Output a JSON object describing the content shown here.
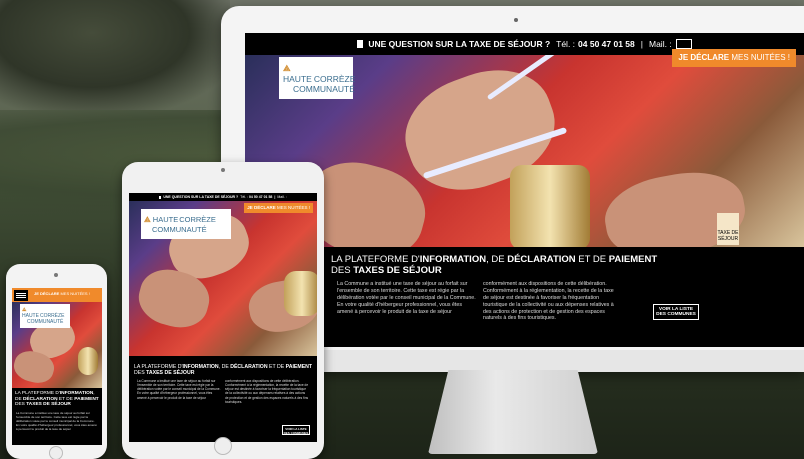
{
  "site": {
    "question_label": "UNE QUESTION SUR LA TAXE DE SÉJOUR ?",
    "tel_label": "Tél. :",
    "tel_value": "04 50 47 01 58",
    "mail_label": "Mail. :",
    "declare_strong": "JE DÉCLARE",
    "declare_light": "MES NUITÉES !",
    "logo_line1": "HAUTE",
    "logo_line1b": "CORRÈZE",
    "logo_line2": "COMMUNAUTÉ",
    "badge_label": "TAXE DE SÉJOUR",
    "title_part1": "LA PLATEFORME D'",
    "title_bold1": "INFORMATION",
    "title_part2": ", DE ",
    "title_bold2": "DÉCLARATION",
    "title_part3": " ET DE ",
    "title_bold3": "PAIEMENT",
    "title_part4": "DES ",
    "title_bold4": "TAXES DE SÉJOUR",
    "col1": "La Commune a institué une taxe de séjour au forfait sur l'ensemble de son territoire. Cette taxe est régie par la délibération votée par le conseil municipal de la Commune. En votre qualité d'hébergeur professionnel, vous êtes amené à percevoir le produit de la taxe de séjour",
    "col2": "conformément aux dispositions de cette délibération. Conformément à la réglementation, la recette de la taxe de séjour est destinée à favoriser la fréquentation touristique de la collectivité ou aux dépenses relatives à des actions de protection et de gestion des espaces naturels à des fins touristiques.",
    "btn_line1": "VOIR LA LISTE",
    "btn_line2": "DES COMMUNES"
  },
  "colors": {
    "accent": "#f08a2b",
    "dark": "#000000"
  },
  "icons": [
    "phone-icon",
    "mail-icon",
    "menu-icon",
    "logo-icon"
  ]
}
